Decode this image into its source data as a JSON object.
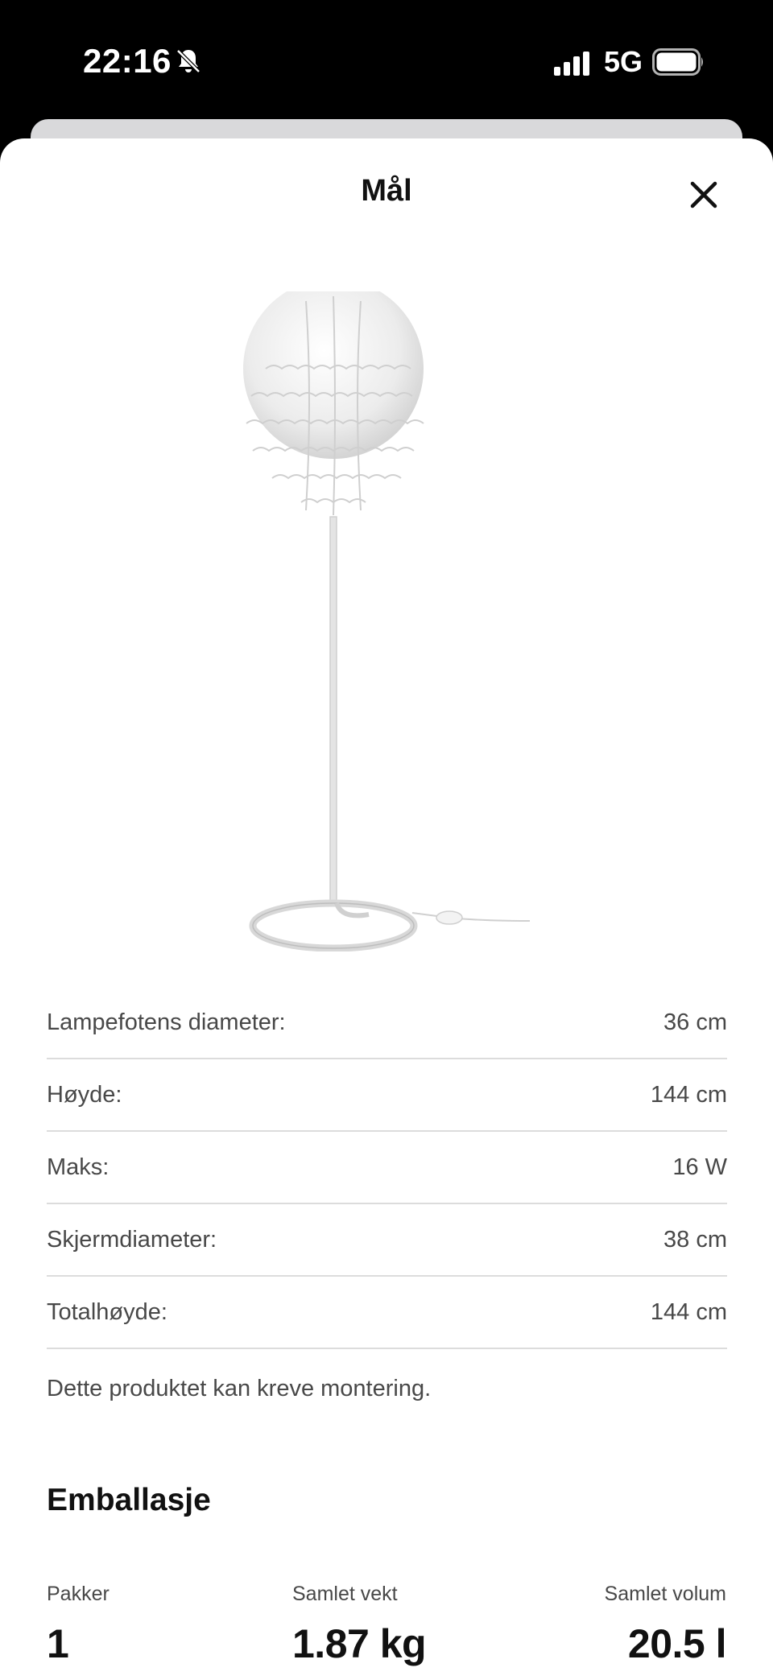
{
  "status_bar": {
    "time": "22:16",
    "network": "5G"
  },
  "sheet": {
    "title": "Mål"
  },
  "specs": [
    {
      "label": "Lampefotens diameter:",
      "value": "36 cm"
    },
    {
      "label": "Høyde:",
      "value": "144 cm"
    },
    {
      "label": "Maks:",
      "value": "16 W"
    },
    {
      "label": "Skjermdiameter:",
      "value": "38 cm"
    },
    {
      "label": "Totalhøyde:",
      "value": "144 cm"
    }
  ],
  "note": "Dette produktet kan kreve montering.",
  "packaging": {
    "title": "Emballasje",
    "packages": {
      "label": "Pakker",
      "value": "1"
    },
    "weight": {
      "label": "Samlet vekt",
      "value": "1.87 kg"
    },
    "volume": {
      "label": "Samlet volum",
      "value": "20.5 l"
    }
  }
}
